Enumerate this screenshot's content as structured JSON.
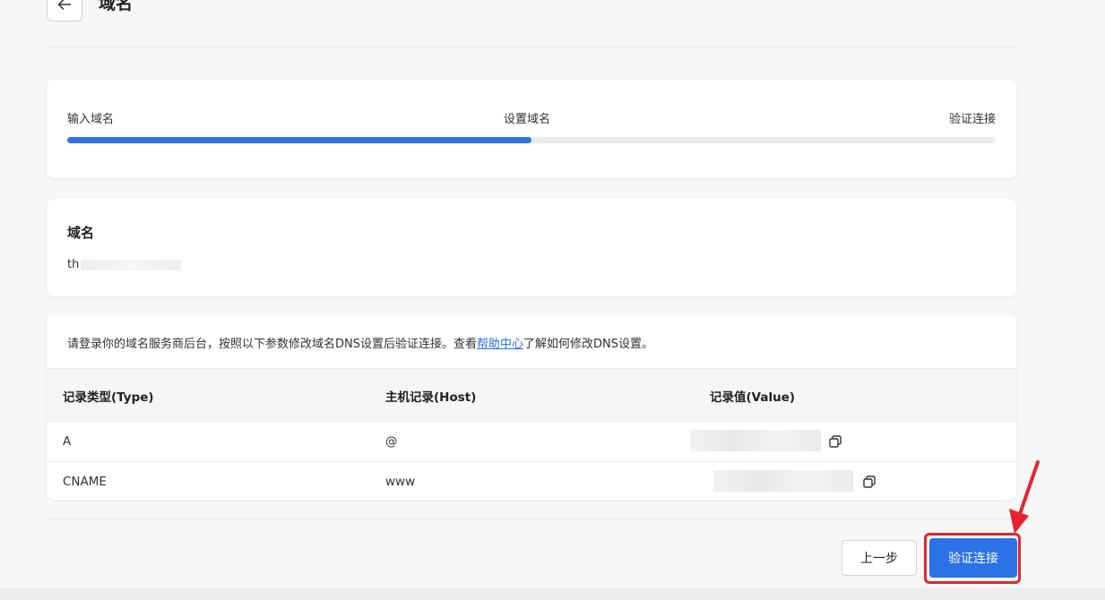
{
  "header": {
    "title": "域名",
    "back_icon": "arrow-left-icon"
  },
  "steps": {
    "items": [
      "输入域名",
      "设置域名",
      "验证连接"
    ],
    "progress_fraction": 0.5
  },
  "domain": {
    "label": "域名",
    "value_visible": "th"
  },
  "dns": {
    "instruction_prefix": "请登录你的域名服务商后台，按照以下参数修改域名DNS设置后验证连接。查看",
    "help_link": "帮助中心",
    "instruction_suffix": "了解如何修改DNS设置。",
    "columns": [
      "记录类型(Type)",
      "主机记录(Host)",
      "记录值(Value)"
    ],
    "rows": [
      {
        "type": "A",
        "host": "@"
      },
      {
        "type": "CNAME",
        "host": "www"
      }
    ],
    "copy_icon": "copy-icon"
  },
  "footer": {
    "prev_label": "上一步",
    "verify_label": "验证连接"
  },
  "colors": {
    "accent": "#2a72e6",
    "annotation": "#e8232f"
  }
}
